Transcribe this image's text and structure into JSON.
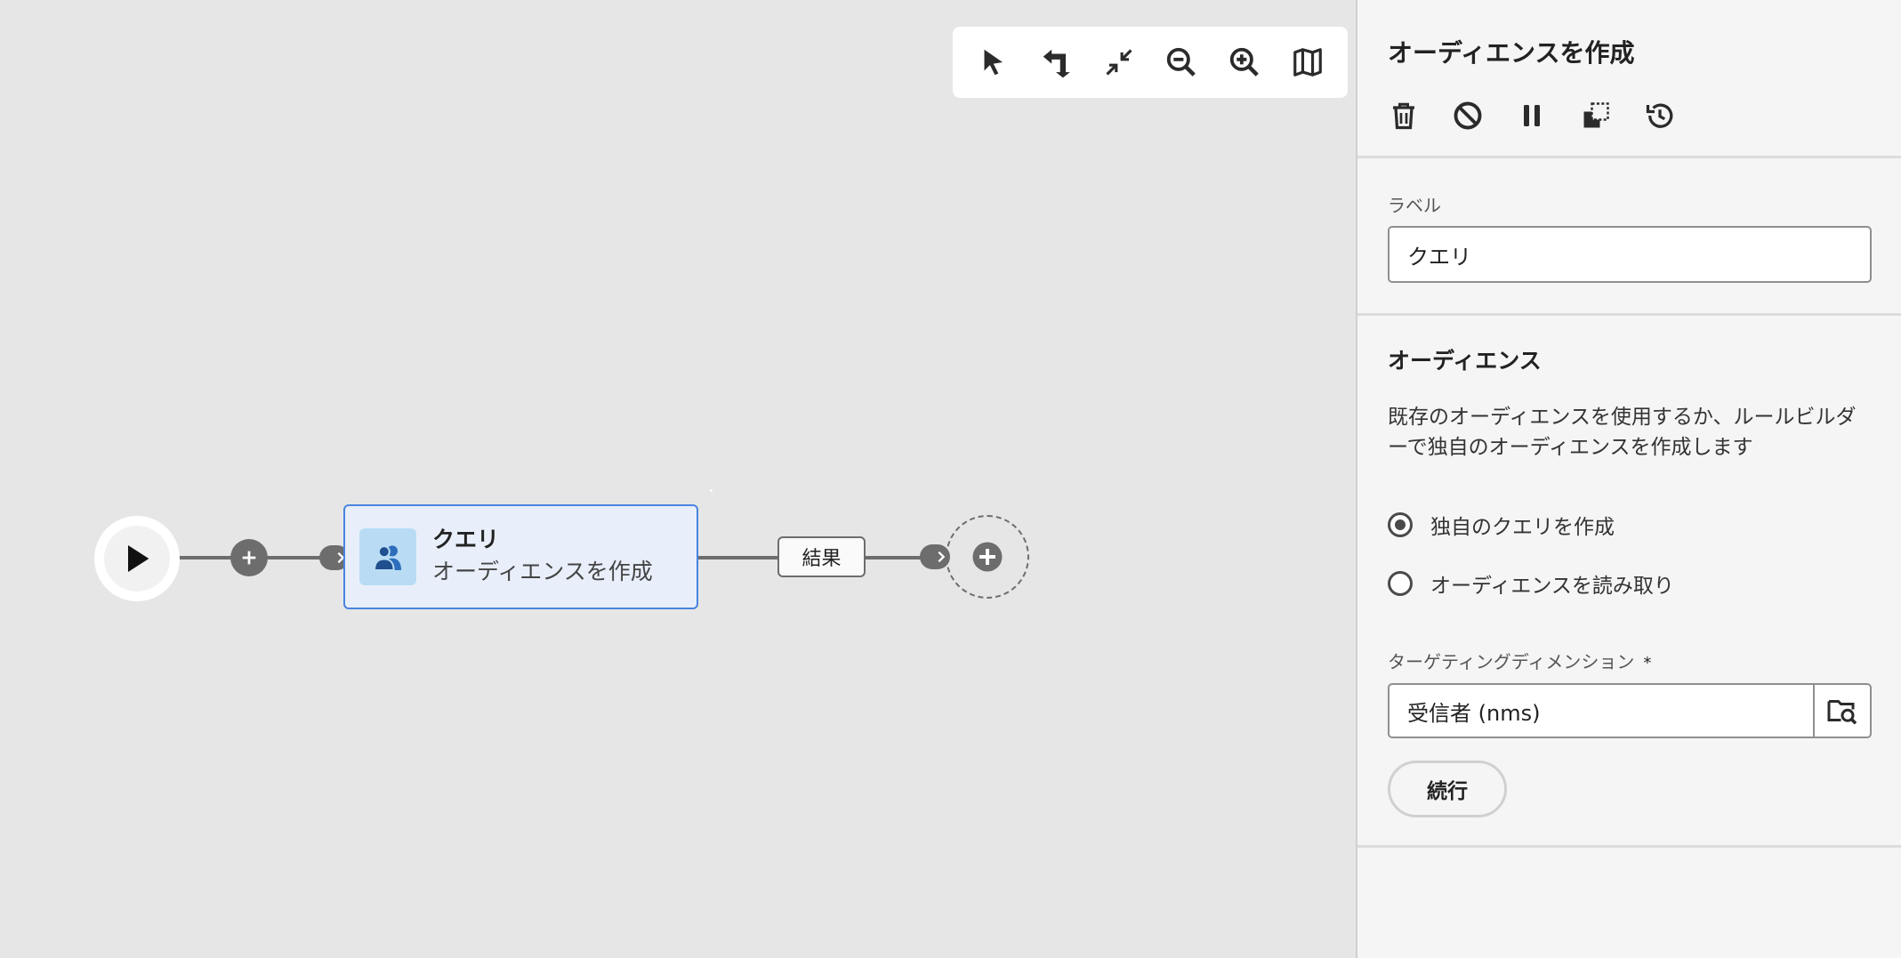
{
  "canvas": {
    "toolbar": {
      "tools": [
        {
          "name": "select-tool",
          "icon": "cursor-icon"
        },
        {
          "name": "rearrange-tool",
          "icon": "arrange-icon"
        },
        {
          "name": "collapse-tool",
          "icon": "collapse-icon"
        },
        {
          "name": "zoom-out-tool",
          "icon": "zoom-out-icon"
        },
        {
          "name": "zoom-in-tool",
          "icon": "zoom-in-icon"
        },
        {
          "name": "minimap-tool",
          "icon": "map-icon"
        }
      ]
    },
    "activity": {
      "title": "クエリ",
      "subtitle": "オーディエンスを作成"
    },
    "transition_label": "結果"
  },
  "panel": {
    "title": "オーディエンスを作成",
    "actions": [
      "delete-icon",
      "disable-icon",
      "pause-icon",
      "copy-icon",
      "history-icon"
    ],
    "label_field": {
      "label": "ラベル",
      "value": "クエリ"
    },
    "audience": {
      "heading": "オーディエンス",
      "description": "既存のオーディエンスを使用するか、ルールビルダーで独自のオーディエンスを作成します",
      "options": [
        {
          "label": "独自のクエリを作成",
          "checked": true
        },
        {
          "label": "オーディエンスを読み取り",
          "checked": false
        }
      ],
      "targeting": {
        "label": "ターゲティングディメンション",
        "required_mark": "*",
        "value": "受信者 (nms)"
      },
      "continue_label": "続行"
    }
  },
  "colors": {
    "canvas_bg": "#e6e6e6",
    "panel_bg": "#f5f5f5",
    "node_accent": "#4a84e0",
    "node_fill": "#e8effb",
    "wire": "#6d6d6d"
  }
}
